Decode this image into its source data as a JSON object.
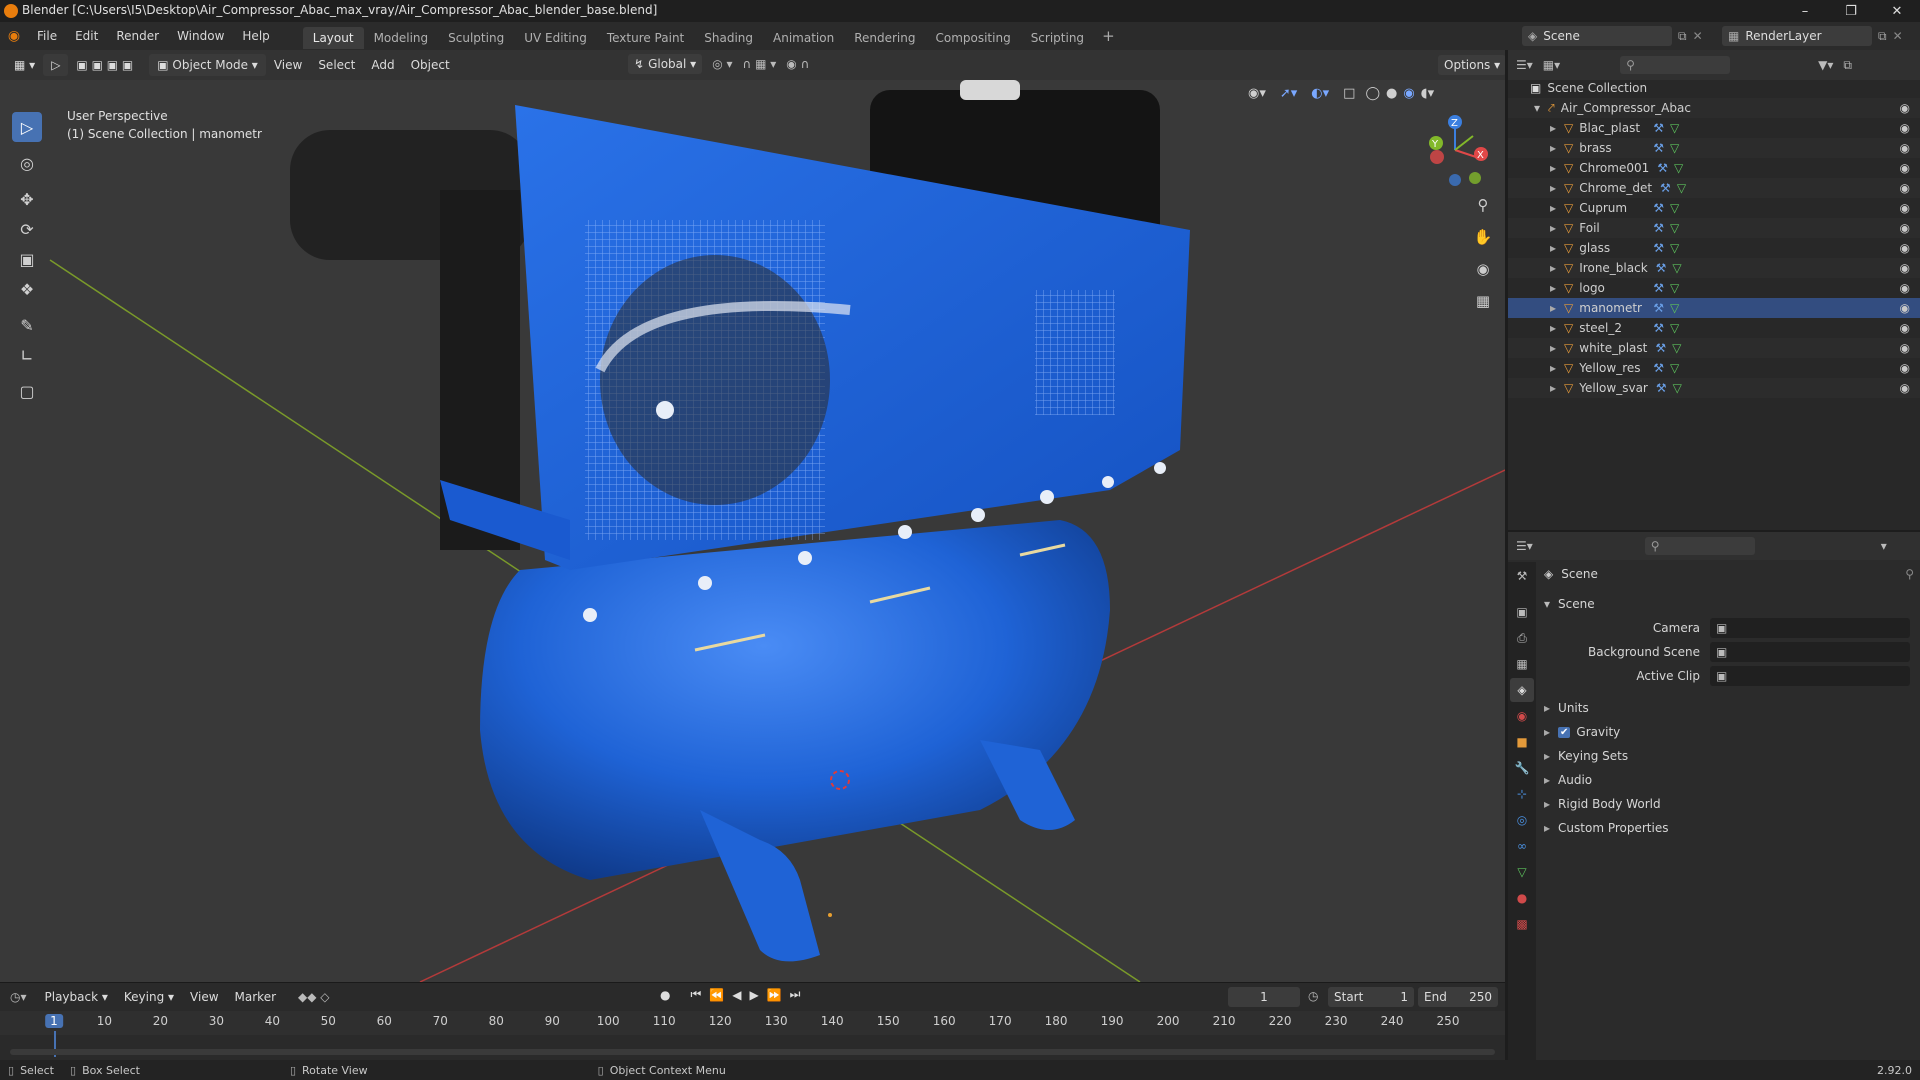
{
  "window": {
    "title": "Blender [C:\\Users\\I5\\Desktop\\Air_Compressor_Abac_max_vray/Air_Compressor_Abac_blender_base.blend]"
  },
  "menu": [
    "File",
    "Edit",
    "Render",
    "Window",
    "Help"
  ],
  "workspaces": [
    {
      "label": "Layout",
      "active": true
    },
    {
      "label": "Modeling",
      "active": false
    },
    {
      "label": "Sculpting",
      "active": false
    },
    {
      "label": "UV Editing",
      "active": false
    },
    {
      "label": "Texture Paint",
      "active": false
    },
    {
      "label": "Shading",
      "active": false
    },
    {
      "label": "Animation",
      "active": false
    },
    {
      "label": "Rendering",
      "active": false
    },
    {
      "label": "Compositing",
      "active": false
    },
    {
      "label": "Scripting",
      "active": false
    }
  ],
  "scene_selector": {
    "value": "Scene"
  },
  "renderlayer_selector": {
    "value": "RenderLayer"
  },
  "viewport": {
    "mode": "Object Mode",
    "menus": [
      "View",
      "Select",
      "Add",
      "Object"
    ],
    "transform_orientation": "Global",
    "options_label": "Options",
    "overlay_line1": "User Perspective",
    "overlay_line2": "(1) Scene Collection | manometr",
    "colors": {
      "background": "#393939",
      "compressor_blue": "#1f63d6",
      "selected": "#e8a030"
    }
  },
  "outliner": {
    "root": "Scene Collection",
    "collection": "Air_Compressor_Abac",
    "objects": [
      "Blac_plast",
      "brass",
      "Chrome001",
      "Chrome_det",
      "Cuprum",
      "Foil",
      "glass",
      "Irone_black",
      "logo",
      "manometr",
      "steel_2",
      "white_plast",
      "Yellow_res",
      "Yellow_svar"
    ]
  },
  "properties": {
    "header": "Scene",
    "panel_title": "Scene",
    "fields": [
      {
        "label": "Camera",
        "value": ""
      },
      {
        "label": "Background Scene",
        "value": ""
      },
      {
        "label": "Active Clip",
        "value": ""
      }
    ],
    "sections": [
      {
        "label": "Units",
        "checkbox": false
      },
      {
        "label": "Gravity",
        "checkbox": true
      },
      {
        "label": "Keying Sets",
        "checkbox": false
      },
      {
        "label": "Audio",
        "checkbox": false
      },
      {
        "label": "Rigid Body World",
        "checkbox": false
      },
      {
        "label": "Custom Properties",
        "checkbox": false
      }
    ]
  },
  "timeline": {
    "menus": [
      "Playback",
      "Keying",
      "View",
      "Marker"
    ],
    "current_frame": "1",
    "start_label": "Start",
    "start_value": "1",
    "end_label": "End",
    "end_value": "250",
    "ruler": [
      "1",
      "10",
      "20",
      "30",
      "40",
      "50",
      "60",
      "70",
      "80",
      "90",
      "100",
      "110",
      "120",
      "130",
      "140",
      "150",
      "160",
      "170",
      "180",
      "190",
      "200",
      "210",
      "220",
      "230",
      "240",
      "250"
    ]
  },
  "statusbar": {
    "items": [
      "Select",
      "Box Select",
      "Rotate View",
      "Object Context Menu"
    ],
    "version": "2.92.0"
  }
}
